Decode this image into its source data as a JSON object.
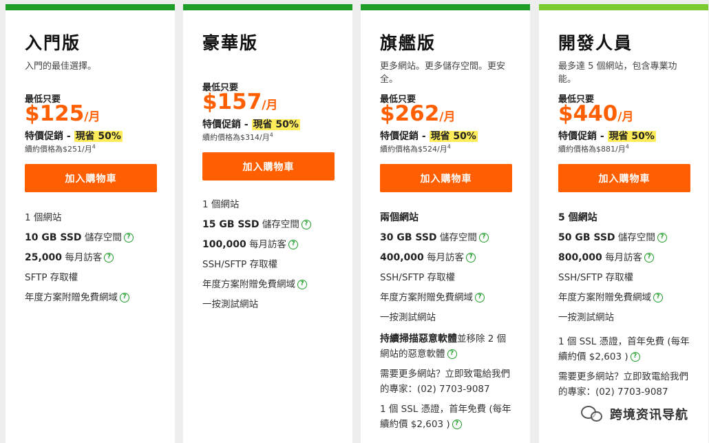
{
  "plans": [
    {
      "name": "入門版",
      "desc": "入門的最佳選擇。",
      "from": "最低只要",
      "price": "$125",
      "per": "/月",
      "promo_prefix": "特價促銷 - ",
      "promo_save": "現省 50%",
      "renew": "續約價格為$251/月",
      "sup": "4",
      "button": "加入購物車",
      "features": [
        "1 個網站",
        "10 GB SSD",
        "儲存空間",
        "25,000",
        "每月訪客",
        "SFTP 存取權",
        "年度方案附贈免費網域"
      ]
    },
    {
      "name": "豪華版",
      "desc": "",
      "from": "最低只要",
      "price": "$157",
      "per": "/月",
      "promo_prefix": "特價促銷 - ",
      "promo_save": "現省 50%",
      "renew": "續約價格為$314/月",
      "sup": "4",
      "button": "加入購物車",
      "features": [
        "1 個網站",
        "15 GB SSD",
        "儲存空間",
        "100,000",
        "每月訪客",
        "SSH/SFTP 存取權",
        "年度方案附贈免費網域",
        "一按測試網站"
      ]
    },
    {
      "name": "旗艦版",
      "desc": "更多網站。更多儲存空間。更安全。",
      "from": "最低只要",
      "price": "$262",
      "per": "/月",
      "promo_prefix": "特價促銷 - ",
      "promo_save": "現省 50%",
      "renew": "續約價格為$524/月",
      "sup": "4",
      "button": "加入購物車",
      "features": [
        "兩個網站",
        "30 GB SSD",
        "儲存空間",
        "400,000",
        "每月訪客",
        "SSH/SFTP 存取權",
        "年度方案附贈免費網域",
        "一按測試網站",
        "持續掃描惡意軟體",
        "並移除 2 個網站的惡意軟體",
        "需要更多網站？立即致電給我們的專家：(02) 7703-9087",
        "1 個 SSL 憑證，首年免費 (每年續約價 $2,603 )"
      ]
    },
    {
      "name": "開發人員",
      "desc": "最多達 5 個網站，包含專業功能。",
      "from": "最低只要",
      "price": "$440",
      "per": "/月",
      "promo_prefix": "特價促銷 - ",
      "promo_save": "現省 50%",
      "renew": "續約價格為$881/月",
      "sup": "4",
      "button": "加入購物車",
      "features": [
        "5 個網站",
        "50 GB SSD",
        "儲存空間",
        "800,000",
        "每月訪客",
        "SSH/SFTP 存取權",
        "年度方案附贈免費網域",
        "一按測試網站",
        "1 個 SSL 憑證，首年免費 (每年續約價 $2,603 )",
        "需要更多網站？立即致電給我們的專家：(02) 7703-9087"
      ]
    }
  ],
  "help_icon": "question-circle-icon",
  "accent_color": "#ff5f00",
  "top_bar_color": "#1e9e28",
  "watermark": "跨境资讯导航"
}
